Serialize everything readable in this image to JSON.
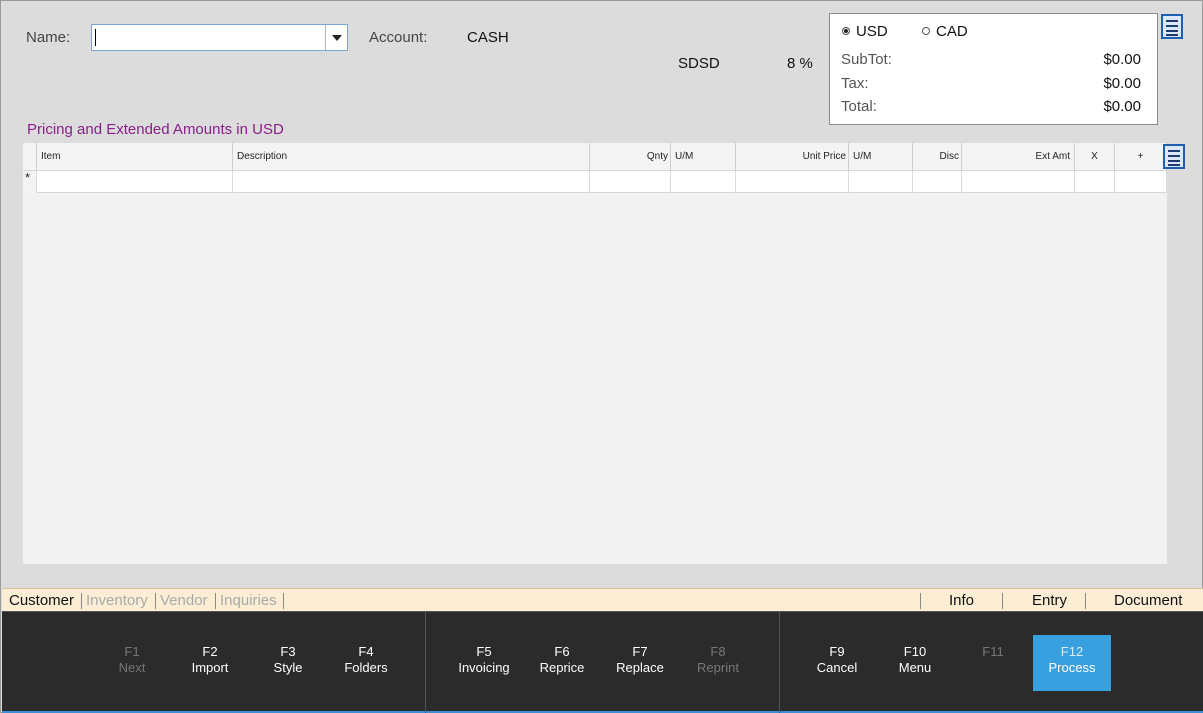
{
  "header": {
    "name_label": "Name:",
    "name_value": "",
    "account_label": "Account:",
    "account_value": "CASH",
    "tax_code": "SDSD",
    "tax_rate": "8 %"
  },
  "totals": {
    "currency_options": [
      {
        "label": "USD",
        "selected": true
      },
      {
        "label": "CAD",
        "selected": false
      }
    ],
    "subtotal_label": "SubTot:",
    "subtotal_value": "$0.00",
    "tax_label": "Tax:",
    "tax_value": "$0.00",
    "total_label": "Total:",
    "total_value": "$0.00"
  },
  "section_title": "Pricing and Extended Amounts in USD",
  "grid": {
    "columns": [
      {
        "key": "item",
        "label": "Item"
      },
      {
        "key": "description",
        "label": "Description"
      },
      {
        "key": "qnty",
        "label": "Qnty"
      },
      {
        "key": "um1",
        "label": "U/M"
      },
      {
        "key": "unit_price",
        "label": "Unit Price"
      },
      {
        "key": "um2",
        "label": "U/M"
      },
      {
        "key": "disc",
        "label": "Disc"
      },
      {
        "key": "ext_amt",
        "label": "Ext Amt"
      },
      {
        "key": "x",
        "label": "X"
      },
      {
        "key": "plus",
        "label": "+"
      }
    ],
    "new_row_marker": "*"
  },
  "tabs": {
    "left": [
      "Customer",
      "Inventory",
      "Vendor",
      "Inquiries"
    ],
    "active": "Customer",
    "right": [
      "Info",
      "Entry",
      "Document"
    ]
  },
  "function_keys": [
    {
      "key": "F1",
      "label": "Next",
      "enabled": false
    },
    {
      "key": "F2",
      "label": "Import",
      "enabled": true
    },
    {
      "key": "F3",
      "label": "Style",
      "enabled": true
    },
    {
      "key": "F4",
      "label": "Folders",
      "enabled": true
    },
    {
      "key": "F5",
      "label": "Invoicing",
      "enabled": true
    },
    {
      "key": "F6",
      "label": "Reprice",
      "enabled": true
    },
    {
      "key": "F7",
      "label": "Replace",
      "enabled": true
    },
    {
      "key": "F8",
      "label": "Reprint",
      "enabled": false
    },
    {
      "key": "F9",
      "label": "Cancel",
      "enabled": true
    },
    {
      "key": "F10",
      "label": "Menu",
      "enabled": true
    },
    {
      "key": "F11",
      "label": "",
      "enabled": false
    },
    {
      "key": "F12",
      "label": "Process",
      "enabled": true,
      "primary": true
    }
  ],
  "icons": {
    "totals_menu": "hamburger-menu-icon",
    "grid_menu": "hamburger-menu-icon",
    "name_dropdown": "chevron-down-icon"
  },
  "colors": {
    "section_title": "#8a1e8a",
    "primary_button": "#39a0e0",
    "function_bar": "#2b2b2b",
    "tabs_bar": "#fbeed5"
  }
}
